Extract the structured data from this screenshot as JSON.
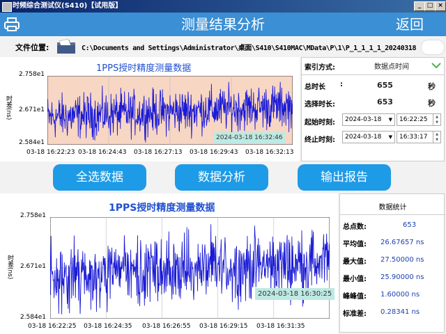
{
  "window": {
    "title": "时频综合测试仪(S410)【试用版】",
    "buttons": [
      "_",
      "□",
      "×"
    ]
  },
  "header": {
    "title": "测量结果分析",
    "back_label": "返回"
  },
  "file": {
    "label": "文件位置:",
    "path": "C:\\Documents and Settings\\Administrator\\桌面\\S410\\S410MAC\\MData\\P\\1\\P_1_1_1_1_20240318"
  },
  "chart_top": {
    "title": "1PPS授时精度测量数据",
    "ylabel": "时差(ns)",
    "yticks": [
      "2.758e1",
      "2.671e1",
      "2.584e1"
    ],
    "xticks": [
      "03-18 16:22:23",
      "03-18 16:24:43",
      "03-18 16:27:13",
      "03-18 16:29:43",
      "03-18 16:32:13"
    ],
    "tooltip": "2024-03-18 16:32:46",
    "background": "#f8d6c4"
  },
  "chart_bottom": {
    "title": "1PPS授时精度测量数据",
    "ylabel": "时差(ns)",
    "yticks": [
      "2.758e1",
      "2.671e1",
      "2.584e1"
    ],
    "xticks": [
      "03-18 16:22:25",
      "03-18 16:24:35",
      "03-18 16:26:55",
      "03-18 16:29:15",
      "03-18 16:31:35"
    ],
    "tooltip": "2024-03-18 16:30:25"
  },
  "chart_data": [
    {
      "type": "line",
      "title": "1PPS授时精度测量数据",
      "ylabel": "时差(ns)",
      "ylim": [
        25.84,
        27.58
      ],
      "x_range": [
        "2024-03-18 16:22:10",
        "2024-03-18 16:33:17"
      ],
      "color": "#1a1ad6",
      "points_count": 653,
      "y_stats": {
        "mean": 26.67657,
        "max": 27.5,
        "min": 25.9
      }
    },
    {
      "type": "line",
      "title": "1PPS授时精度测量数据",
      "ylabel": "时差(ns)",
      "ylim": [
        25.84,
        27.58
      ],
      "x_range": [
        "2024-03-18 16:22:10",
        "2024-03-18 16:33:17"
      ],
      "color": "#1a1ad6",
      "points_count": 653,
      "y_stats": {
        "mean": 26.67657,
        "max": 27.5,
        "min": 25.9
      }
    }
  ],
  "panel": {
    "index_label": "索引方式:",
    "index_value": "数据点时间",
    "total_label": "总时长",
    "total_colon": ":",
    "total_value": "655",
    "total_unit": "秒",
    "sel_label": "选择时长:",
    "sel_value": "653",
    "sel_unit": "秒",
    "start_label": "起始时刻:",
    "start_date": "2024-03-18",
    "start_time": "16:22:25",
    "end_label": "终止时刻:",
    "end_date": "2024-03-18",
    "end_time": "16:33:17"
  },
  "buttons": {
    "select_all": "全选数据",
    "analyze": "数据分析",
    "report": "输出报告"
  },
  "stats": {
    "title": "数据统计",
    "rows": [
      {
        "label": "总点数:",
        "value": "653"
      },
      {
        "label": "平均值:",
        "value": "26.67657 ns"
      },
      {
        "label": "最大值:",
        "value": "27.50000 ns"
      },
      {
        "label": "最小值:",
        "value": "25.90000 ns"
      },
      {
        "label": "峰峰值:",
        "value": "1.60000 ns"
      },
      {
        "label": "标准差:",
        "value": "0.28341 ns"
      }
    ]
  },
  "colors": {
    "header": "#3b8fd4",
    "button": "#1e9be6",
    "line": "#1a1ad6",
    "panel_check": "#4caf50"
  }
}
